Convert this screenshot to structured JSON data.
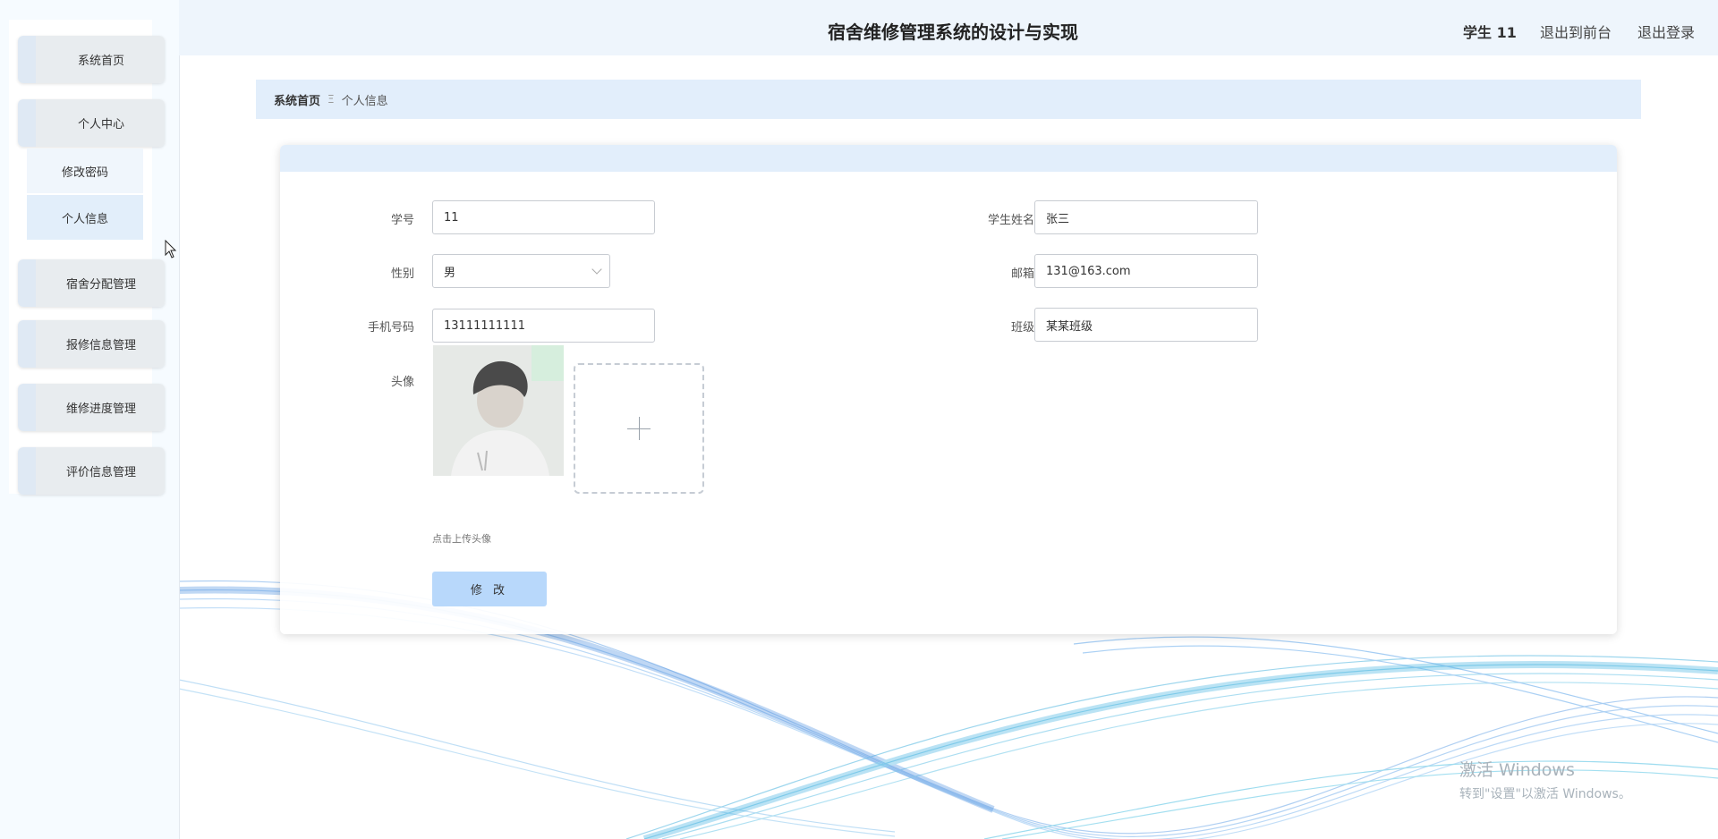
{
  "header": {
    "title": "宿舍维修管理系统的设计与实现",
    "user_label": "学生 11",
    "back_front_label": "退出到前台",
    "logout_label": "退出登录"
  },
  "sidebar": {
    "items": [
      {
        "label": "系统首页"
      },
      {
        "label": "个人中心"
      },
      {
        "label": "宿舍分配管理"
      },
      {
        "label": "报修信息管理"
      },
      {
        "label": "维修进度管理"
      },
      {
        "label": "评价信息管理"
      }
    ],
    "sub_items": [
      {
        "label": "修改密码"
      },
      {
        "label": "个人信息",
        "active": true
      }
    ]
  },
  "breadcrumb": {
    "home": "系统首页",
    "separator": "Ξ",
    "current": "个人信息"
  },
  "form": {
    "student_id": {
      "label": "学号",
      "value": "11"
    },
    "student_name": {
      "label": "学生姓名",
      "value": "张三"
    },
    "gender": {
      "label": "性别",
      "value": "男"
    },
    "email": {
      "label": "邮箱",
      "value": "131@163.com"
    },
    "phone": {
      "label": "手机号码",
      "value": "13111111111"
    },
    "class": {
      "label": "班级",
      "value": "某某班级"
    },
    "avatar": {
      "label": "头像"
    },
    "upload_hint": "点击上传头像",
    "submit_label": "修 改"
  },
  "watermark": {
    "line1": "激活 Windows",
    "line2": "转到\"设置\"以激活 Windows。"
  },
  "colors": {
    "header_bg": "#eef5fc",
    "breadcrumb_bg": "#e2eefb",
    "button_bg": "#b8d8fb",
    "sidebar_bg": "#f6fbff"
  }
}
